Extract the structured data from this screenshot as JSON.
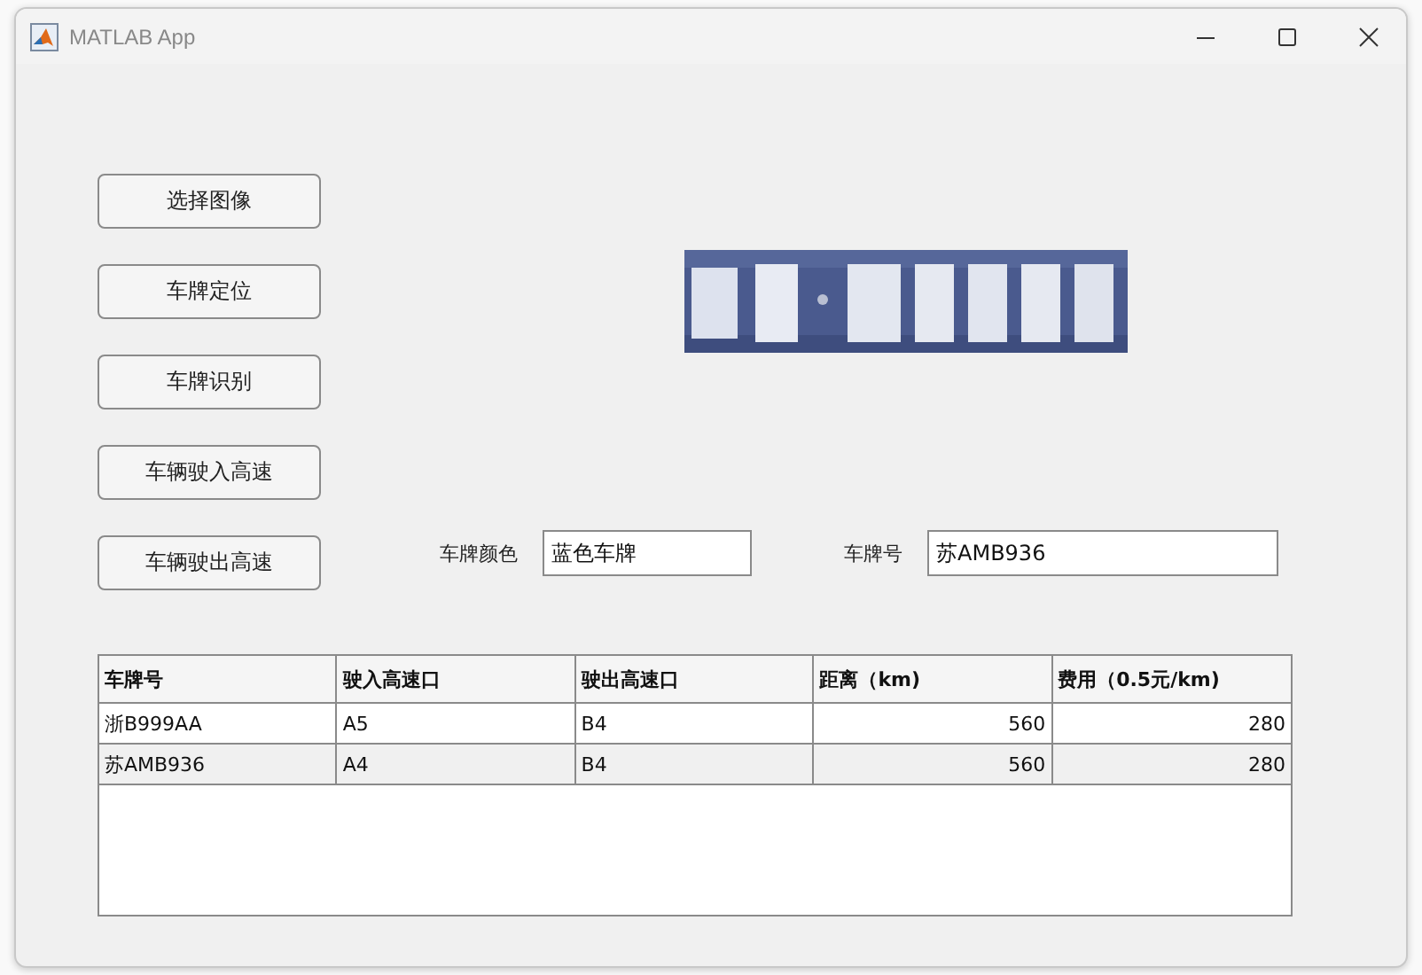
{
  "window": {
    "title": "MATLAB App"
  },
  "buttons": [
    "选择图像",
    "车牌定位",
    "车牌识别",
    "车辆驶入高速",
    "车辆驶出高速"
  ],
  "fields": [
    {
      "label": "车牌颜色",
      "value": "蓝色车牌"
    },
    {
      "label": "车牌号",
      "value": "苏AMB936"
    }
  ],
  "table": {
    "columns": [
      "车牌号",
      "驶入高速口",
      "驶出高速口",
      "距离（km)",
      "费用（0.5元/km)"
    ],
    "rows": [
      [
        "浙B999AA",
        "A5",
        "B4",
        "560",
        "280"
      ],
      [
        "苏AMB936",
        "A4",
        "B4",
        "560",
        "280"
      ]
    ]
  }
}
